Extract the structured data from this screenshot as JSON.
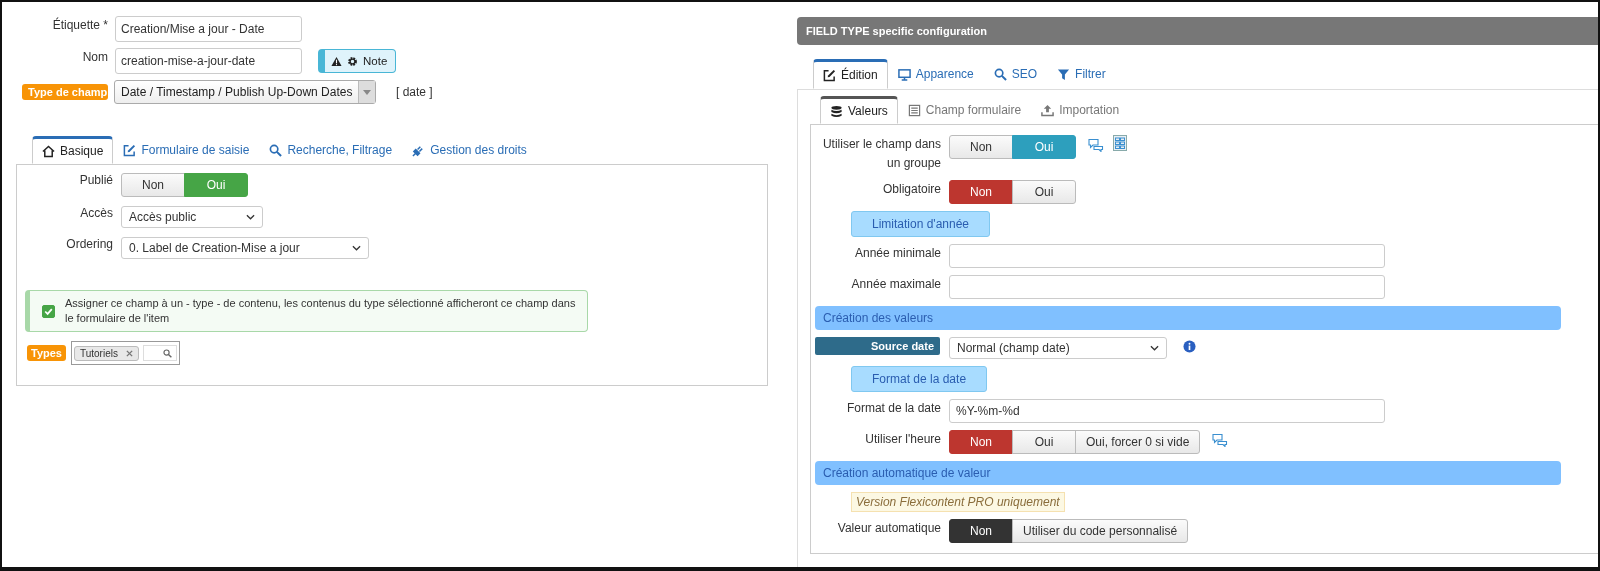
{
  "general": {
    "fields": [
      {
        "label": "Étiquette *",
        "value": "Creation/Mise a jour - Date"
      },
      {
        "label": "Nom",
        "value": "creation-mise-a-jour-date"
      }
    ],
    "note_button": "Note",
    "field_type": {
      "label": "Type de champ",
      "value": "Date / Timestamp / Publish Up-Down Dates",
      "code": "[ date ]"
    }
  },
  "left_tabs": [
    {
      "label": "Basique",
      "selected": true
    },
    {
      "label": "Formulaire de saisie",
      "selected": false
    },
    {
      "label": "Recherche, Filtrage",
      "selected": false
    },
    {
      "label": "Gestion des droits",
      "selected": false
    }
  ],
  "basic": {
    "rows": [
      {
        "kind": "toggle",
        "label": "Publié",
        "color": "#46a546",
        "options": [
          {
            "label": "Non",
            "selected": false
          },
          {
            "label": "Oui",
            "selected": true
          }
        ]
      },
      {
        "kind": "select",
        "label": "Accès",
        "value": "Accès public"
      },
      {
        "kind": "select",
        "label": "Ordering",
        "value": "0. Label de Creation-Mise a jour"
      }
    ],
    "notice": {
      "checked": true,
      "text": "Assigner ce champ à un - type - de contenu, les contenus du type sélectionné afficheront ce champ dans le formulaire de l'item"
    },
    "types": {
      "label": "Types",
      "tags": [
        "Tutoriels"
      ]
    }
  },
  "config": {
    "title": "FIELD TYPE specific configuration",
    "tabs": [
      {
        "label": "Édition",
        "selected": true
      },
      {
        "label": "Apparence",
        "selected": false
      },
      {
        "label": "SEO",
        "selected": false
      },
      {
        "label": "Filtrer",
        "selected": false
      }
    ],
    "subtabs": [
      {
        "label": "Valeurs",
        "selected": true
      },
      {
        "label": "Champ formulaire",
        "selected": false
      },
      {
        "label": "Importation",
        "selected": false
      }
    ],
    "items": [
      {
        "kind": "toggle",
        "label": "Utiliser le champ dans un groupe",
        "color": "#2d9fbd",
        "help": true,
        "layout_icon": true,
        "options": [
          {
            "label": "Non",
            "selected": false
          },
          {
            "label": "Oui",
            "selected": true
          }
        ]
      },
      {
        "kind": "toggle",
        "label": "Obligatoire",
        "color": "#bd362f",
        "options": [
          {
            "label": "Non",
            "selected": true
          },
          {
            "label": "Oui",
            "selected": false
          }
        ]
      },
      {
        "kind": "pill",
        "label": "Limitation d'année"
      },
      {
        "kind": "input",
        "label": "Année minimale"
      },
      {
        "kind": "input",
        "label": "Année maximale"
      },
      {
        "kind": "section",
        "label": "Création des valeurs"
      },
      {
        "kind": "select",
        "label": "Source date",
        "value": "Normal (champ date)",
        "info": true
      },
      {
        "kind": "pill",
        "label": "Format de la date"
      },
      {
        "kind": "input",
        "label": "Format de la date",
        "value": "%Y-%m-%d"
      },
      {
        "kind": "toggle",
        "label": "Utiliser l'heure",
        "color": "#bd362f",
        "help": true,
        "options": [
          {
            "label": "Non",
            "selected": true
          },
          {
            "label": "Oui",
            "selected": false
          },
          {
            "label": "Oui, forcer 0 si vide",
            "selected": false
          }
        ]
      },
      {
        "kind": "section",
        "label": "Création automatique de valeur"
      },
      {
        "kind": "warning",
        "label": "Version Flexicontent PRO uniquement"
      },
      {
        "kind": "toggle",
        "label": "Valeur automatique",
        "color": "#333333",
        "options": [
          {
            "label": "Non",
            "selected": true
          },
          {
            "label": "Utiliser du code personnalisé",
            "selected": false
          }
        ]
      }
    ]
  }
}
